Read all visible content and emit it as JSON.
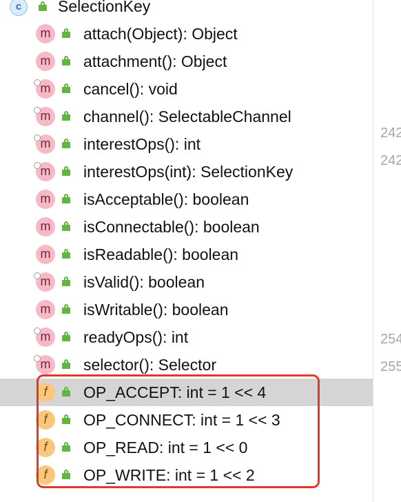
{
  "structure": {
    "class_name": "SelectionKey",
    "class_icon_letter": "c",
    "members": [
      {
        "icon": "m",
        "label": "attach(Object): Object",
        "override": false
      },
      {
        "icon": "m",
        "label": "attachment(): Object",
        "override": false
      },
      {
        "icon": "m",
        "label": "cancel(): void",
        "override": true
      },
      {
        "icon": "m",
        "label": "channel(): SelectableChannel",
        "override": true
      },
      {
        "icon": "m",
        "label": "interestOps(): int",
        "override": true
      },
      {
        "icon": "m",
        "label": "interestOps(int): SelectionKey",
        "override": true
      },
      {
        "icon": "m",
        "label": "isAcceptable(): boolean",
        "override": false
      },
      {
        "icon": "m",
        "label": "isConnectable(): boolean",
        "override": false
      },
      {
        "icon": "m",
        "label": "isReadable(): boolean",
        "override": false
      },
      {
        "icon": "m",
        "label": "isValid(): boolean",
        "override": true
      },
      {
        "icon": "m",
        "label": "isWritable(): boolean",
        "override": false
      },
      {
        "icon": "m",
        "label": "readyOps(): int",
        "override": true
      },
      {
        "icon": "m",
        "label": "selector(): Selector",
        "override": true
      },
      {
        "icon": "f",
        "label": "OP_ACCEPT: int = 1 << 4",
        "selected": true
      },
      {
        "icon": "f",
        "label": "OP_CONNECT: int = 1 << 3"
      },
      {
        "icon": "f",
        "label": "OP_READ: int = 1 << 0"
      },
      {
        "icon": "f",
        "label": "OP_WRITE: int = 1 << 2"
      }
    ]
  },
  "gutter": {
    "line_numbers": [
      "242",
      "242",
      "254",
      "255"
    ]
  },
  "colors": {
    "method_icon": "#f7b9c6",
    "field_icon": "#f9c77d",
    "lock_green": "#62b543",
    "selection": "#d5d5d5",
    "highlight_border": "#e3372b"
  }
}
